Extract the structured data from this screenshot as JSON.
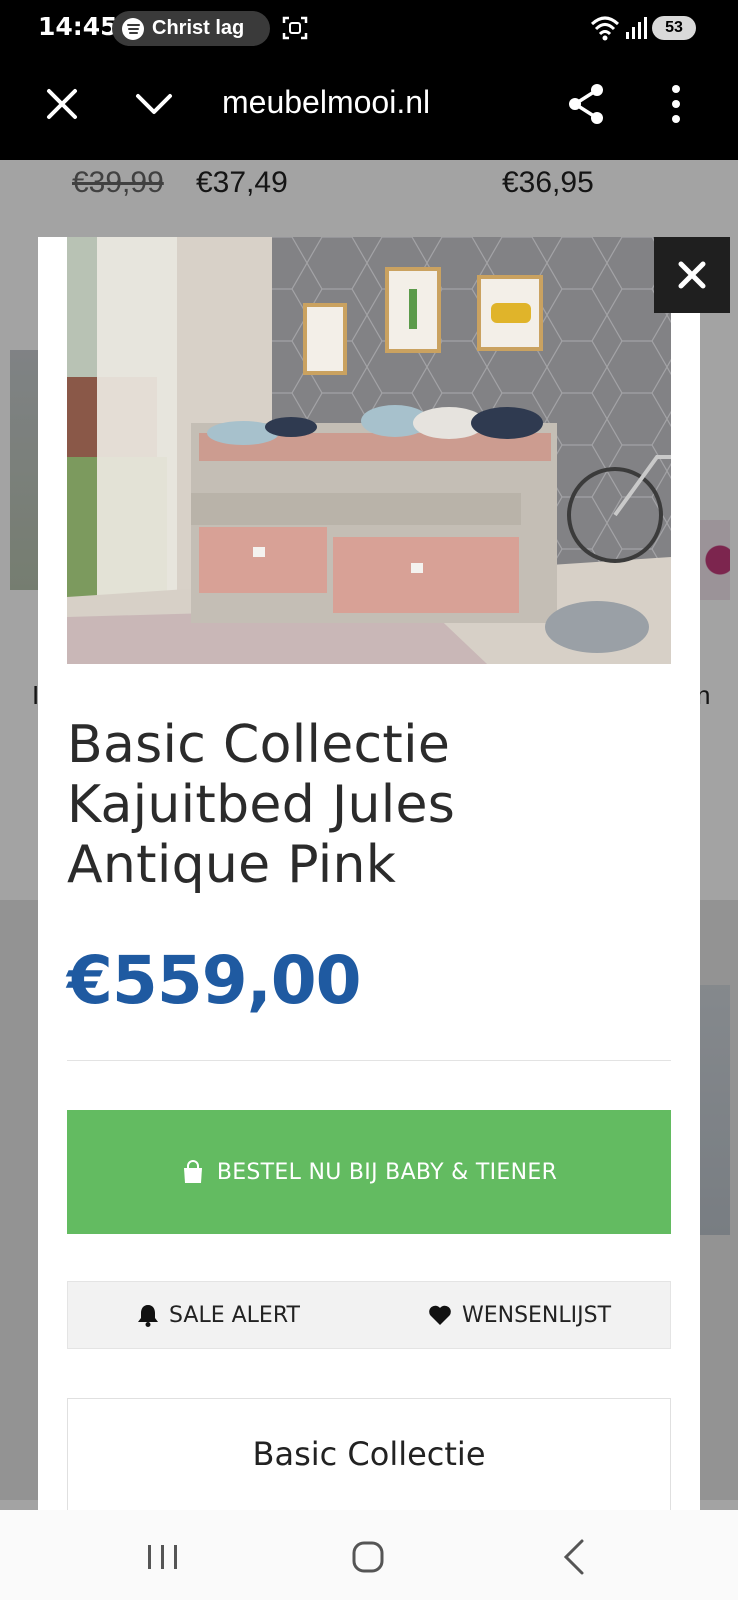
{
  "status_bar": {
    "time": "14:45",
    "media_text": "Christ lag",
    "battery": "53"
  },
  "browser": {
    "domain": "meubelmooi.nl"
  },
  "background_page": {
    "old_price": "€39,99",
    "new_price": "€37,49",
    "right_price": "€36,95",
    "left_fragment": "I",
    "right_fragment": "n"
  },
  "modal": {
    "image_alt": "Kajuitbed with pink drawers in a grey bedroom",
    "title": "Basic Collectie Kajuitbed Jules Antique Pink",
    "price": "€559,00",
    "order_button_label": "BESTEL NU BIJ BABY & TIENER",
    "sale_alert_label": "SALE ALERT",
    "wishlist_label": "WENSENLIJST",
    "brand_title": "Basic Collectie"
  },
  "colors": {
    "price": "#1f5aa1",
    "order_button": "#63bb61"
  },
  "icons": {
    "close": "close-icon",
    "share": "share-icon",
    "menu": "more-vert-icon",
    "bag": "shopping-bag-icon",
    "bell": "bell-icon",
    "heart": "heart-icon"
  }
}
